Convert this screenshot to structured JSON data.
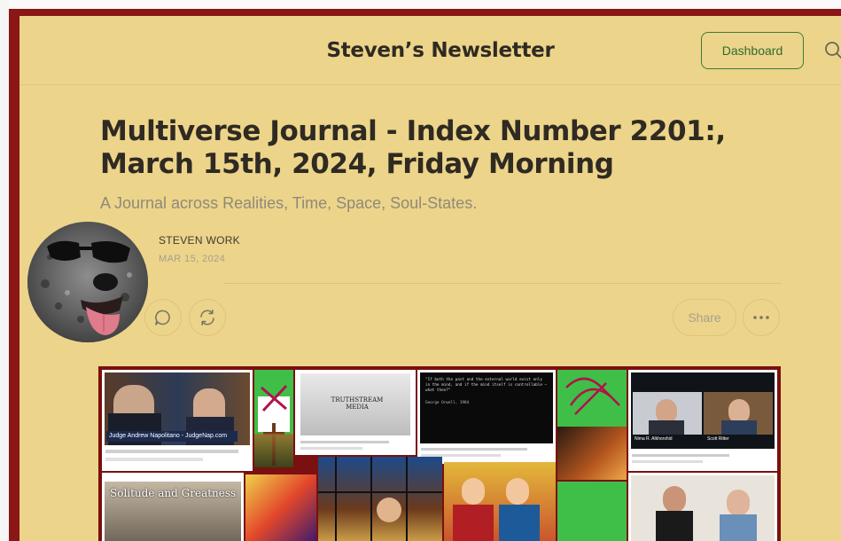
{
  "header": {
    "site_title": "Steven’s Newsletter",
    "dashboard_label": "Dashboard"
  },
  "post": {
    "title": "Multiverse Journal - Index Number 2201:, March 15th, 2024, Friday Morning",
    "subtitle": "A Journal across Realities, Time, Space, Soul-States.",
    "author": "STEVEN WORK",
    "date": "MAR 15, 2024"
  },
  "actions": {
    "share_label": "Share"
  },
  "collage": {
    "video1_caption": "Judge Andrew Napolitano - JudgeNap.com",
    "video2_title": "TRUTHSTREAM MEDIA",
    "video3_quote": "\"If both the past and the external world exist only in the mind, and if the mind itself is controllable – what then?\"",
    "video3_attribution": "George Orwell, 1984",
    "video4_left_name": "Nima R. Alkhorshid",
    "video4_right_name": "Scott Ritter",
    "video5_title": "Solitude and Greatness"
  }
}
